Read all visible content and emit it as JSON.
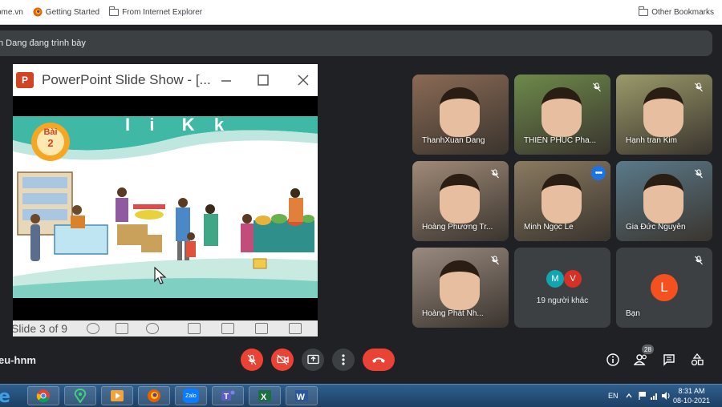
{
  "browser": {
    "bookmarks": [
      {
        "label": "ome.vn",
        "icon": "site-icon"
      },
      {
        "label": "Getting Started",
        "icon": "firefox-icon"
      },
      {
        "label": "From Internet Explorer",
        "icon": "folder-icon"
      }
    ],
    "other_bookmarks": "Other Bookmarks"
  },
  "presenter_banner": "n Dang đang trình bày",
  "presentation": {
    "window_title": "PowerPoint Slide Show - [...",
    "window_controls": [
      "minimize-icon",
      "maximize-icon",
      "close-icon"
    ],
    "slide": {
      "lesson_badge_word": "Bài",
      "lesson_number": "2",
      "heading": "I  i   K  k"
    },
    "status": "Slide 3 of 9"
  },
  "participants": [
    {
      "name": "ThanhXuan Dang",
      "muted": false,
      "bg": "#8a6a55"
    },
    {
      "name": "THIÊN PHÚC Pha...",
      "muted": true,
      "bg": "#6d8a4a"
    },
    {
      "name": "Hạnh tran Kim",
      "muted": true,
      "bg": "#9a9a6a"
    },
    {
      "name": "Hoàng Phương Tr...",
      "muted": true,
      "bg": "#a08a78"
    },
    {
      "name": "Minh Ngọc Le",
      "muted": false,
      "active": true,
      "bg": "#8a7a60"
    },
    {
      "name": "Gia Đức Nguyễn",
      "muted": true,
      "bg": "#5a7a8a"
    },
    {
      "name": "Hoàng Phát Nh...",
      "muted": true,
      "bg": "#9a8a80"
    }
  ],
  "others_tile": {
    "label": "19 người khác",
    "avatars": [
      "M",
      "V"
    ],
    "avatar_colors": [
      "#12a4af",
      "#d93025"
    ]
  },
  "self_tile": {
    "name": "Bạn",
    "initial": "L",
    "avatar_color": "#f4511e"
  },
  "meeting": {
    "code": "eu-hnm",
    "people_count": "28"
  },
  "taskbar": {
    "apps": [
      "chrome",
      "maps",
      "player",
      "firefox",
      "Zalo",
      "teams",
      "excel",
      "word"
    ],
    "zalo_label": "Zalo",
    "lang": "EN",
    "time": "8:31 AM",
    "date": "08-10-2021"
  },
  "colors": {
    "meet_bg": "#202124",
    "red": "#ea4335",
    "tile": "#3c4043",
    "accent": "#1a73e8"
  }
}
